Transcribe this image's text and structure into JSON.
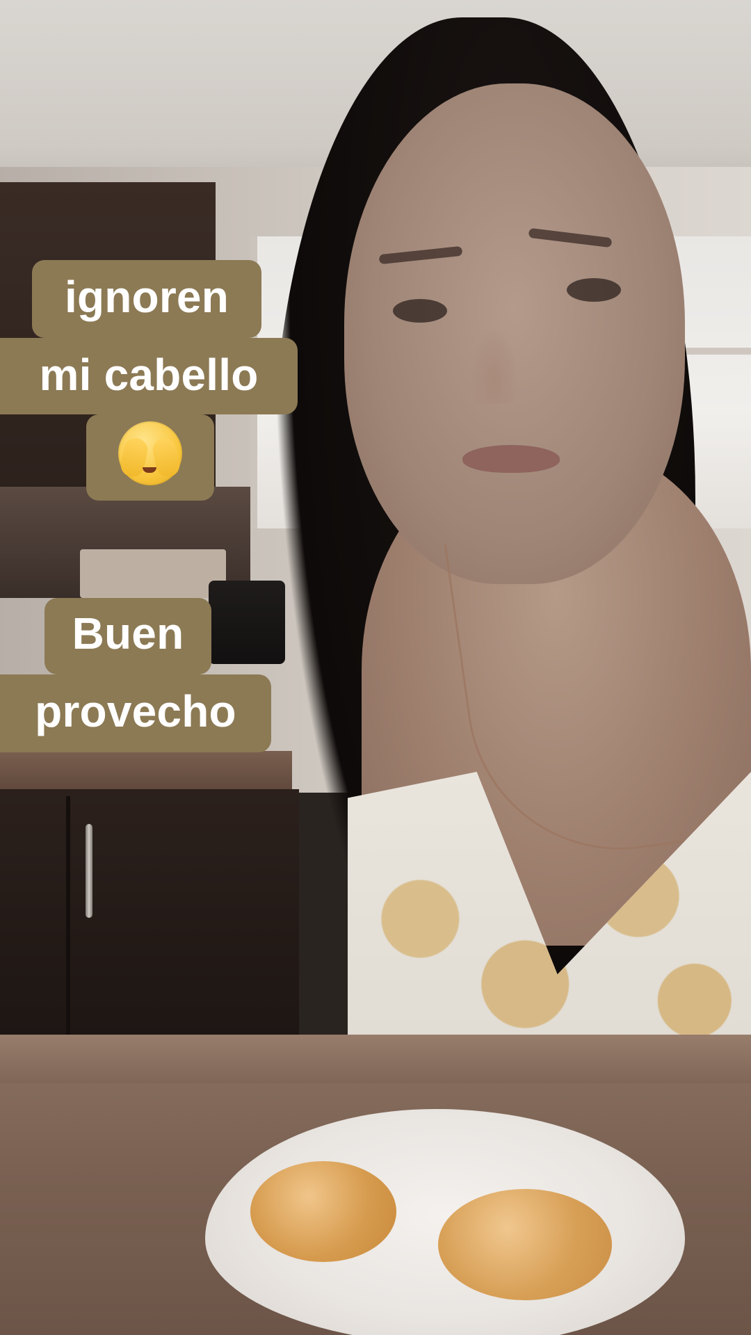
{
  "overlays": {
    "caption_1": {
      "line_1": "ignoren",
      "line_2": "mi cabello",
      "emoji": "🫣"
    },
    "caption_2": {
      "line_1": "Buen",
      "line_2": "provecho"
    }
  },
  "colors": {
    "caption_background": "#8c7a55",
    "caption_text": "#ffffff"
  }
}
